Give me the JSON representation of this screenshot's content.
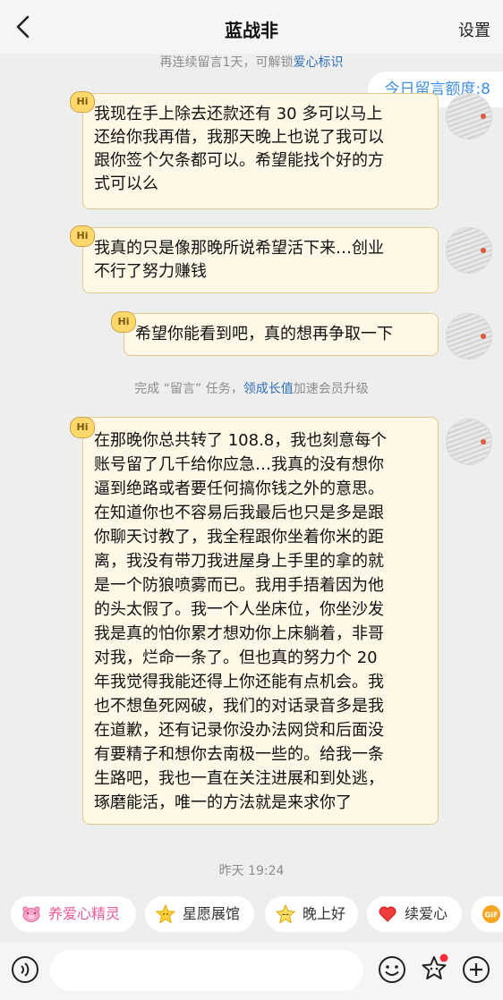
{
  "header": {
    "title": "蓝战非",
    "settings_label": "设置"
  },
  "system_top": {
    "text": "再连续留言1天，可解锁",
    "link": "爱心标识"
  },
  "quota": {
    "label": "今日留言额度:8"
  },
  "messages": [
    {
      "badge": "Hi",
      "lines": [
        "我现在手上除去还款还有 30 多可以马上",
        "还给你我再借，我那天晚上也说了我可以",
        "跟你签个欠条都可以。希望能找个好的方",
        "式可以么"
      ]
    },
    {
      "badge": "Hi",
      "lines": [
        "我真的只是像那晚所说希望活下来…创业",
        "不行了努力赚钱"
      ]
    },
    {
      "badge": "Hi",
      "lines": [
        "希望你能看到吧，真的想再争取一下"
      ]
    },
    {
      "badge": "Hi",
      "lines": [
        "在那晚你总共转了 108.8，我也刻意每个",
        "账号留了几千给你应急…我真的没有想你",
        "逼到绝路或者要任何搞你钱之外的意思。",
        "在知道你也不容易后我最后也只是多是跟",
        "你聊天讨教了，我全程跟你坐着你米的距",
        "离，我没有带刀我进屋身上手里的拿的就",
        "是一个防狼喷雾而已。我用手捂着因为他",
        "的头太假了。我一个人坐床位，你坐沙发",
        "我是真的怕你累才想劝你上床躺着，非哥",
        "对我，烂命一条了。但也真的努力个 20",
        "年我觉得我能还得上你还能有点机会。我",
        "也不想鱼死网破，我们的对话录音多是我",
        "在道歉，还有记录你没办法网贷和后面没",
        "有要精子和想你去南极一些的。给我一条",
        "生路吧，我也一直在关注进展和到处逃，",
        "琢磨能活，唯一的方法就是来求你了"
      ]
    }
  ],
  "system_mid": {
    "pre": "完成 “留言” 任务，",
    "link": "领成长值",
    "post": "加速会员升级"
  },
  "timestamp": "昨天 19:24",
  "quick_actions": [
    {
      "label": "养爱心精灵",
      "icon": "pig-icon"
    },
    {
      "label": "星愿展馆",
      "icon": "star-face-icon"
    },
    {
      "label": "晚上好",
      "icon": "sleepy-face-icon"
    },
    {
      "label": "续爱心",
      "icon": "heart-icon"
    },
    {
      "label": "GIF",
      "icon": "gif-icon"
    }
  ],
  "colors": {
    "bubble_bg": "#fff8e6",
    "bubble_border": "#e6c98f",
    "link": "#2f6fb8",
    "quota": "#3d8fe6",
    "accent_pink": "#e85a9c"
  }
}
